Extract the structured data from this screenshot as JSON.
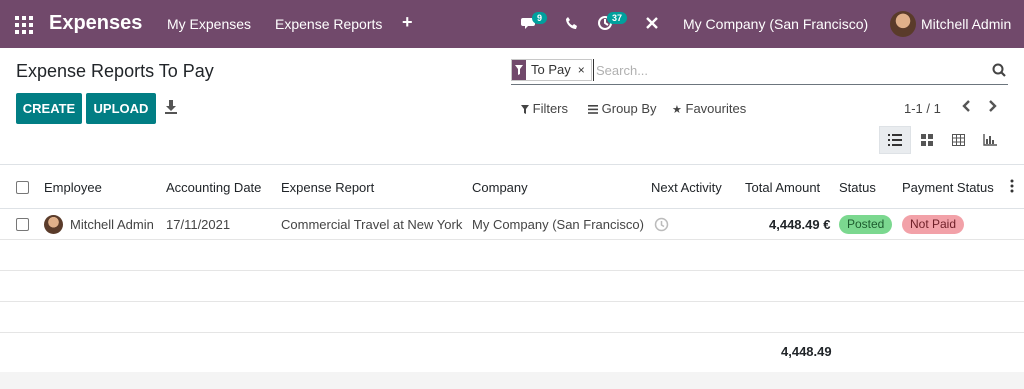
{
  "navbar": {
    "app_name": "Expenses",
    "menu": [
      "My Expenses",
      "Expense Reports"
    ],
    "plus_label": "+",
    "messages_count": "9",
    "activities_count": "37",
    "company": "My Company (San Francisco)",
    "user": "Mitchell Admin"
  },
  "page": {
    "title": "Expense Reports To Pay",
    "create_label": "CREATE",
    "upload_label": "UPLOAD"
  },
  "search": {
    "facet": "To Pay",
    "facet_remove": "×",
    "placeholder": "Search..."
  },
  "controls": {
    "filters": "Filters",
    "group_by": "Group By",
    "favourites": "Favourites",
    "pager": "1-1 / 1"
  },
  "table": {
    "columns": [
      "Employee",
      "Accounting Date",
      "Expense Report",
      "Company",
      "Next Activity",
      "Total Amount",
      "Status",
      "Payment Status"
    ],
    "rows": [
      {
        "employee": "Mitchell Admin",
        "accounting_date": "17/11/2021",
        "expense_report": "Commercial Travel at New York",
        "company": "My Company (San Francisco)",
        "total_amount": "4,448.49 €",
        "status": "Posted",
        "payment_status": "Not Paid"
      }
    ],
    "footer_total": "4,448.49"
  },
  "colors": {
    "navbar": "#71496b",
    "primary_button": "#017e84",
    "badge": "#00a09d",
    "posted_pill": "#7bd88f",
    "not_paid_pill": "#f2a1a8"
  }
}
